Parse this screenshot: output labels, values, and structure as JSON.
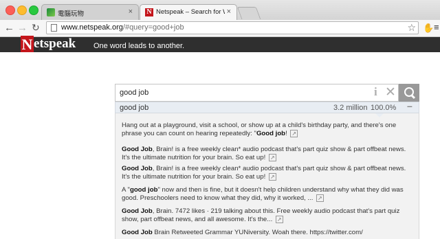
{
  "browser": {
    "tabs": [
      {
        "title": "電腦玩物",
        "close": "×"
      },
      {
        "title": "Netspeak – Search for Wor",
        "close": "×"
      }
    ],
    "nav": {
      "back": "←",
      "forward": "→",
      "reload": "↻"
    },
    "url_host": "www.netspeak.org",
    "url_path": "/#query=good+job",
    "star": "☆",
    "extension_icon": "✋",
    "menu_icon": "≡"
  },
  "header": {
    "logo_initial": "N",
    "logo_rest": "etspeak",
    "tagline": "One word leads to another."
  },
  "search": {
    "query": "good job",
    "info_icon": "i",
    "clear_icon": "✕"
  },
  "result": {
    "phrase": "good job",
    "count": "3.2 million",
    "percent": "100.0%",
    "collapse": "–"
  },
  "snippets": [
    {
      "pre": "Hang out at a playground, visit a school, or show up at a child's birthday party, and there's one phrase you can count on hearing repeatedly: \"",
      "bold": "Good job",
      "post": "! ",
      "ext": "↗"
    },
    {
      "pre": "",
      "bold": "Good Job",
      "post": ", Brain! is a free weekly clean* audio podcast that's part quiz show & part offbeat news. It's the ultimate nutrition for your brain. So eat up! ",
      "ext": "↗"
    },
    {
      "pre": "",
      "bold": "Good Job",
      "post": ", Brain! is a free weekly clean* audio podcast that's part quiz show & part offbeat news. It's the ultimate nutrition for your brain. So eat up! ",
      "ext": "↗"
    },
    {
      "pre": "A \"",
      "bold": "good job",
      "post": "\" now and then is fine, but it doesn't help children understand why what they did was good. Preschoolers need to know what they did, why it worked, ... ",
      "ext": "↗"
    },
    {
      "pre": "",
      "bold": "Good Job",
      "post": ", Brain. 7472 likes · 219 talking about this. Free weekly audio podcast that's part quiz show, part offbeat news, and all awesome. It's the... ",
      "ext": "↗"
    },
    {
      "pre": "",
      "bold": "Good Job",
      "post": " Brain Retweeted Grammar YUNiversity. Woah there. https://twitter.com/",
      "ext": ""
    }
  ]
}
